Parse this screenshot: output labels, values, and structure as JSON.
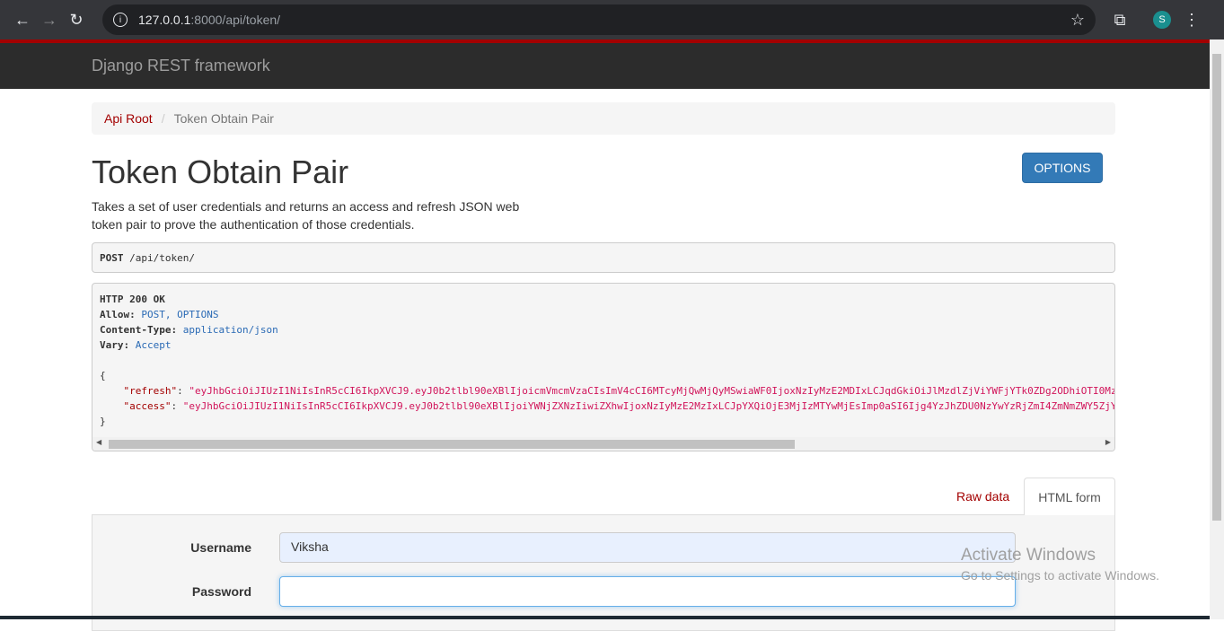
{
  "browser": {
    "url_host": "127.0.0.1",
    "url_path": ":8000/api/token/",
    "profile_initial": "S"
  },
  "navbar": {
    "brand": "Django REST framework"
  },
  "breadcrumb": {
    "root": "Api Root",
    "current": "Token Obtain Pair"
  },
  "page": {
    "title": "Token Obtain Pair",
    "options_label": "OPTIONS",
    "description": "Takes a set of user credentials and returns an access and refresh JSON web token pair to prove the authentication of those credentials."
  },
  "request": {
    "method": "POST",
    "path": "/api/token/"
  },
  "response": {
    "status": "HTTP 200 OK",
    "headers": [
      {
        "k": "Allow",
        "v": "POST, OPTIONS"
      },
      {
        "k": "Content-Type",
        "v": "application/json"
      },
      {
        "k": "Vary",
        "v": "Accept"
      }
    ],
    "refresh": "\"eyJhbGciOiJIUzI1NiIsInR5cCI6IkpXVCJ9.eyJ0b2tlbl90eXBlIjoicmVmcmVzaCIsImV4cCI6MTcyMjQwMjQyMSwiaWF0IjoxNzIyMzE2MDIxLCJqdGkiOiJlMzdlZjViYWFjYTk0ZDg2ODhiOTI0Mz",
    "access": "\"eyJhbGciOiJIUzI1NiIsInR5cCI6IkpXVCJ9.eyJ0b2tlbl90eXBlIjoiYWNjZXNzIiwiZXhwIjoxNzIyMzE2MzIxLCJpYXQiOjE3MjIzMTYwMjEsImp0aSI6Ijg4YzJhZDU0NzYwYzRjZmI4ZmNmZWY5ZjY"
  },
  "tabs": {
    "raw": "Raw data",
    "html": "HTML form"
  },
  "form": {
    "username_label": "Username",
    "username_value": "Viksha",
    "password_label": "Password",
    "password_value": ""
  },
  "watermark": {
    "title": "Activate Windows",
    "subtitle": "Go to Settings to activate Windows."
  }
}
